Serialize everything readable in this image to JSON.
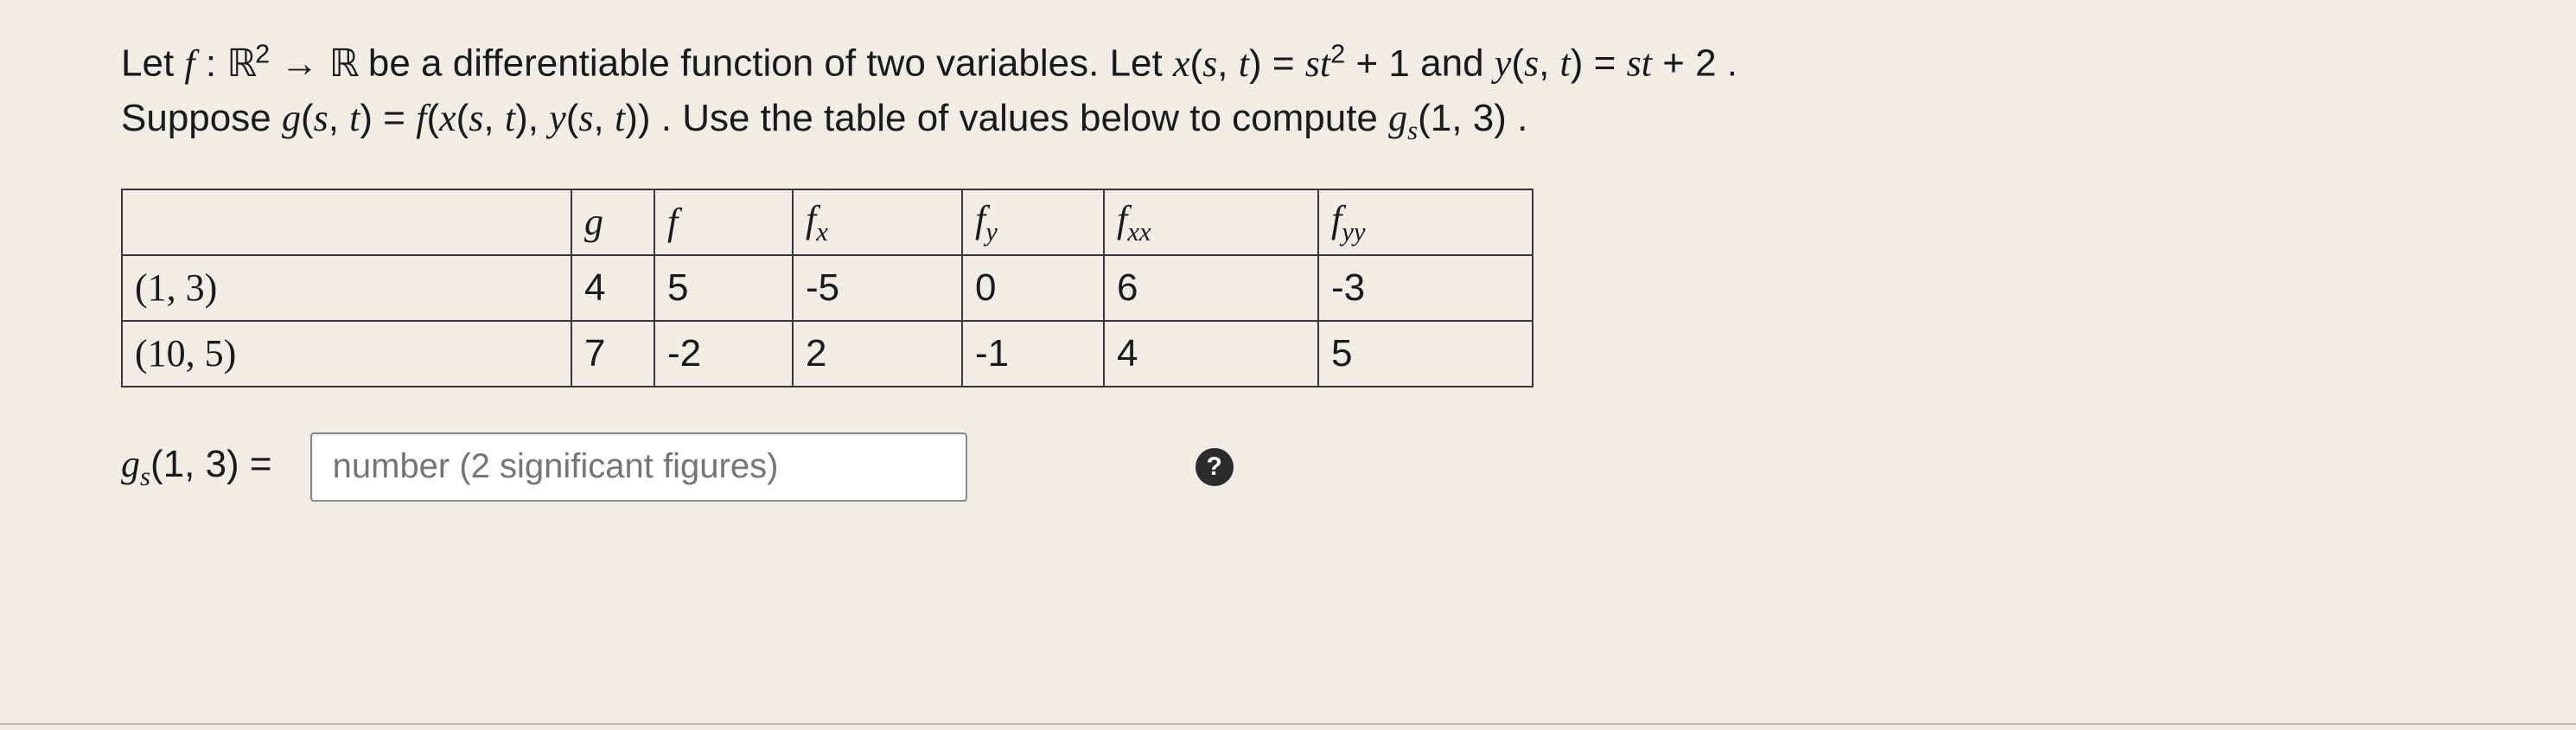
{
  "problem": {
    "sentence1_a": "Let ",
    "fn_decl_html": "<span class='math-ital'>f</span> : <span class='bbR'>ℝ</span><sup>2</sup> → <span class='bbR'>ℝ</span>",
    "sentence1_b": " be a differentiable function of two variables. Let ",
    "x_eq_html": "<span class='math-ital'>x</span>(<span class='math-ital'>s</span>, <span class='math-ital'>t</span>) = <span class='math-ital'>st</span><sup>2</sup> + 1",
    "and": " and ",
    "y_eq_html": "<span class='math-ital'>y</span>(<span class='math-ital'>s</span>, <span class='math-ital'>t</span>) = <span class='math-ital'>st</span> + 2",
    "period1": ".",
    "sentence2_a": "Suppose ",
    "g_eq_html": "<span class='math-ital'>g</span>(<span class='math-ital'>s</span>, <span class='math-ital'>t</span>) = <span class='math-ital'>f</span>(<span class='math-ital'>x</span>(<span class='math-ital'>s</span>, <span class='math-ital'>t</span>), <span class='math-ital'>y</span>(<span class='math-ital'>s</span>, <span class='math-ital'>t</span>))",
    "sentence2_b": ". Use the table of values below to compute ",
    "target_html": "<span class='math-ital'>g<sub>s</sub></span>(1, 3)",
    "period2": "."
  },
  "table": {
    "headers": {
      "blank": "",
      "g": "<span class='math-ital'>g</span>",
      "f": "<span class='math-ital'>f</span>",
      "fx": "<span class='math-ital'>f<sub>x</sub></span>",
      "fy": "<span class='math-ital'>f<sub>y</sub></span>",
      "fxx": "<span class='math-ital'>f<sub>xx</sub></span>",
      "fyy": "<span class='math-ital'>f<sub>yy</sub></span>"
    },
    "rows": [
      {
        "label": "(1, 3)",
        "g": "4",
        "f": "5",
        "fx": "-5",
        "fy": "0",
        "fxx": "6",
        "fyy": "-3"
      },
      {
        "label": "(10, 5)",
        "g": "7",
        "f": "-2",
        "fx": "2",
        "fy": "-1",
        "fxx": "4",
        "fyy": "5"
      }
    ]
  },
  "answer": {
    "label_html": "<span class='math-ital'>g<sub>s</sub></span>(1, 3) =",
    "placeholder": "number (2 significant figures)",
    "help_char": "?"
  }
}
